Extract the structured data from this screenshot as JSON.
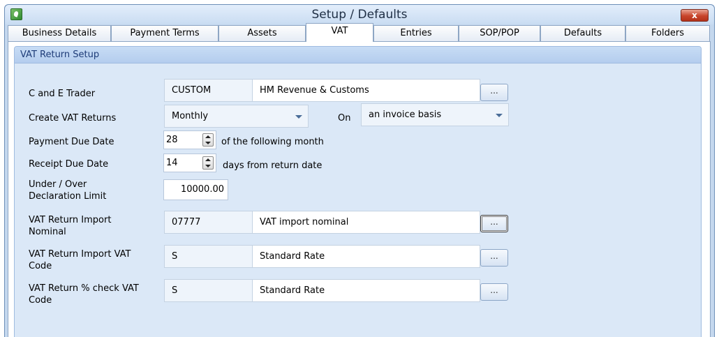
{
  "window": {
    "title": "Setup / Defaults",
    "close_label": "x"
  },
  "tabs": [
    {
      "label": "Business Details",
      "active": false
    },
    {
      "label": "Payment Terms",
      "active": false
    },
    {
      "label": "Assets",
      "active": false
    },
    {
      "label": "VAT",
      "active": true
    },
    {
      "label": "Entries",
      "active": false
    },
    {
      "label": "SOP/POP",
      "active": false
    },
    {
      "label": "Defaults",
      "active": false
    },
    {
      "label": "Folders",
      "active": false
    }
  ],
  "group": {
    "title": "VAT Return Setup"
  },
  "fields": {
    "trader": {
      "label": "C and E Trader",
      "code": "CUSTOM",
      "name": "HM Revenue & Customs",
      "button": "..."
    },
    "create_returns": {
      "label": "Create VAT Returns",
      "value": "Monthly",
      "on_label": "On",
      "basis": "an invoice basis"
    },
    "payment_due": {
      "label": "Payment Due Date",
      "value": "28",
      "suffix": "of the following month"
    },
    "receipt_due": {
      "label": "Receipt Due Date",
      "value": "14",
      "suffix": "days from return date"
    },
    "declaration_limit": {
      "label_line1": "Under / Over",
      "label_line2": "Declaration Limit",
      "value": "10000.00"
    },
    "import_nominal": {
      "label_line1": "VAT Return Import",
      "label_line2": "Nominal",
      "code": "07777",
      "name": "VAT import nominal",
      "button": "..."
    },
    "import_vat_code": {
      "label_line1": "VAT Return Import VAT",
      "label_line2": "Code",
      "code": "S",
      "name": "Standard Rate",
      "button": "..."
    },
    "check_vat_code": {
      "label_line1": "VAT Return % check VAT",
      "label_line2": "Code",
      "code": "S",
      "name": "Standard Rate",
      "button": "..."
    }
  },
  "icons": {
    "app": "app-leaf-icon",
    "close": "close-icon",
    "dropdown": "chevron-down-icon",
    "spinner": "spinner-arrows-icon"
  },
  "colors": {
    "group_header_text": "#1e3c78",
    "close_button": "#c8442b",
    "panel_background": "#dbe8f7"
  }
}
